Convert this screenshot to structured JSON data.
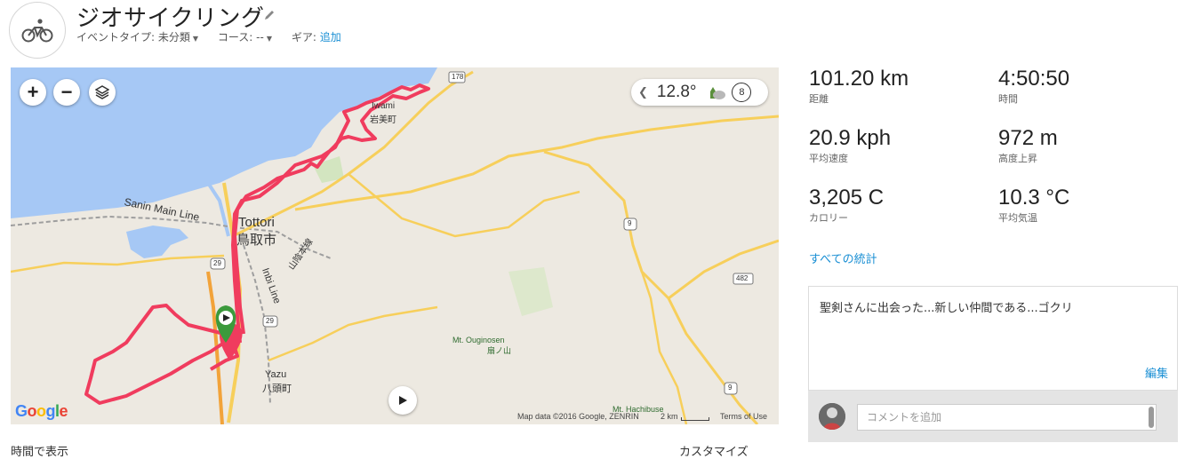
{
  "header": {
    "title": "ジオサイクリング",
    "event_type_label": "イベントタイプ:",
    "event_type_value": "未分類",
    "course_label": "コース:",
    "course_value": "--",
    "gear_label": "ギア:",
    "gear_link": "追加"
  },
  "map": {
    "zoom_in": "+",
    "zoom_out": "−",
    "weather_temp": "12.8°",
    "weather_wind": "8",
    "labels": {
      "sanin": "Sanin Main Line",
      "tottori_en": "Tottori",
      "tottori_jp": "鳥取市",
      "iwami_en": "Iwami",
      "iwami_jp": "岩美町",
      "inbi": "Inbi Line",
      "sanin_jp": "山陰本線",
      "ouginosen_en": "Mt. Ouginosen",
      "ouginosen_jp": "扇ノ山",
      "yazu_en": "Yazu",
      "yazu_jp": "八頭町",
      "hachibuse": "Mt. Hachibuse",
      "r178": "178",
      "r9a": "9",
      "r9b": "9",
      "r29a": "29",
      "r29b": "29",
      "r482": "482"
    },
    "footer": {
      "google": "Google",
      "attribution": "Map data ©2016 Google, ZENRIN",
      "scale": "2 km",
      "terms": "Terms of Use"
    }
  },
  "stats": [
    {
      "value": "101.20 km",
      "label": "距離"
    },
    {
      "value": "4:50:50",
      "label": "時間"
    },
    {
      "value": "20.9 kph",
      "label": "平均速度"
    },
    {
      "value": "972 m",
      "label": "高度上昇"
    },
    {
      "value": "3,205 C",
      "label": "カロリー"
    },
    {
      "value": "10.3 °C",
      "label": "平均気温"
    }
  ],
  "all_stats_link": "すべての統計",
  "description": {
    "text": "聖剣さんに出会った...新しい仲間である...ゴクリ",
    "edit": "編集"
  },
  "comment": {
    "placeholder": "コメントを追加"
  },
  "bottom": {
    "left": "時間で表示",
    "right": "カスタマイズ"
  },
  "colors": {
    "route": "#f03c5e",
    "link": "#1a8fd4",
    "water": "#a6c8f5",
    "land": "#ede9e1",
    "road": "#f7cf5b"
  }
}
